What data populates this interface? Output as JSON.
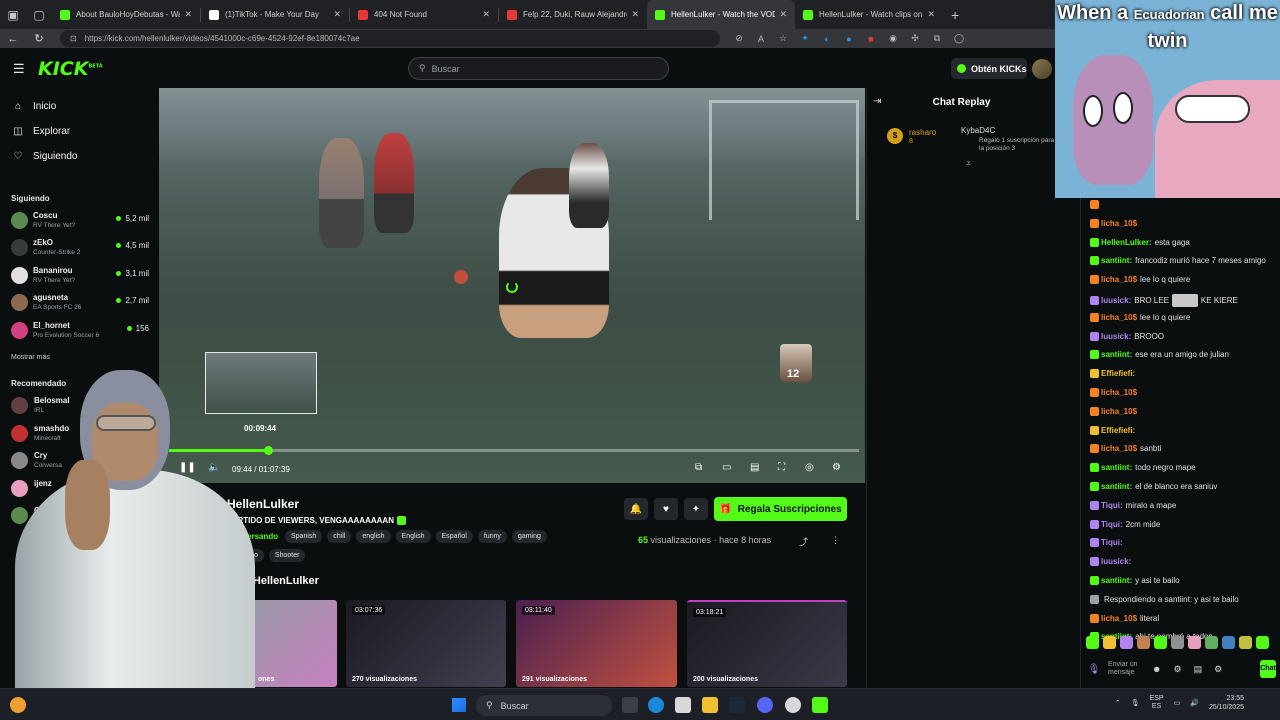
{
  "browser": {
    "tabs": [
      {
        "title": "About BauloHoyDebutas - Watch",
        "color": "#53fc18",
        "active": false
      },
      {
        "title": "(1)TikTok - Make Your Day",
        "color": "#ffffff",
        "active": false
      },
      {
        "title": "404 Not Found",
        "color": "#e53935",
        "active": false
      },
      {
        "title": "Felp 22, Duki, Rauw Alejandro - S",
        "color": "#e53935",
        "active": false
      },
      {
        "title": "HellenLulker - Watch the VOD o",
        "color": "#53fc18",
        "active": true
      },
      {
        "title": "HellenLulker - Watch clips on Ki",
        "color": "#53fc18",
        "active": false
      }
    ],
    "url": "https://kick.com/hellenlulker/videos/4541000c-c69e-4524-92ef-8e180074c7ae"
  },
  "kick": {
    "logo": "KICK",
    "logo_sup": "BETA",
    "search_placeholder": "Buscar",
    "obtener_label": "Obtén KICKs"
  },
  "sidebar": {
    "menu": [
      {
        "label": "Inicio",
        "icon": "home-icon"
      },
      {
        "label": "Explorar",
        "icon": "compass-icon"
      },
      {
        "label": "Siguiendo",
        "icon": "heart-icon"
      }
    ],
    "following_title": "Siguiendo",
    "following": [
      {
        "name": "Coscu",
        "game": "RV There Yet?",
        "viewers": "5,2 mil",
        "color": "#5a8a50"
      },
      {
        "name": "zEkO",
        "game": "Counter-Strike 2",
        "viewers": "4,5 mil",
        "color": "#3a3a3a"
      },
      {
        "name": "Bananirou",
        "game": "RV There Yet?",
        "viewers": "3,1 mil",
        "color": "#e0e0e0"
      },
      {
        "name": "agusneta",
        "game": "EA Sports FC 26",
        "viewers": "2,7 mil",
        "color": "#8c6a50"
      },
      {
        "name": "El_hornet",
        "game": "Pro Evolution Soccer 6",
        "viewers": "156",
        "color": "#d04080"
      }
    ],
    "show_more": "Mostrar más",
    "recommended_title": "Recomendado",
    "recommended": [
      {
        "name": "Belosmal",
        "game": "IRL",
        "color": "#604040"
      },
      {
        "name": "smashdo",
        "game": "Minecraft",
        "color": "#c03030"
      },
      {
        "name": "Cry",
        "game": "Conversa",
        "color": "#888888"
      },
      {
        "name": "ijenz",
        "game": "",
        "color": "#e8a0c0"
      },
      {
        "name": "Cos",
        "game": "",
        "color": "#5a8a50"
      }
    ]
  },
  "video": {
    "preview_time": "00:09:44",
    "current_time": "09:44",
    "total_time": "01:07:39",
    "progress": 0.144,
    "corner_badge": "12"
  },
  "stream": {
    "name": "HellenLulker",
    "title": "PARTIDO DE VIEWERS, VENGAAAAAAAAN",
    "category": "Conversando",
    "tags": [
      "Spanish",
      "chill",
      "english",
      "English",
      "Español",
      "funny",
      "gaming"
    ],
    "tags2": [
      "Grindeo",
      "Shooter"
    ],
    "subscribe_label": "Regala Suscripciones",
    "views_count": "65",
    "views_label": "visualizaciones",
    "time_ago": "hace 8 horas",
    "section_heading": "de HellenLulker"
  },
  "vods": [
    {
      "duration": "",
      "views": "ones",
      "c1": "#9a9aa8",
      "c2": "#c880c0"
    },
    {
      "duration": "03:07:36",
      "views": "270 visualizaciones",
      "c1": "#1a1a22",
      "c2": "#404050"
    },
    {
      "duration": "03:11:40",
      "views": "291 visualizaciones",
      "c1": "#4a2050",
      "c2": "#c05040"
    },
    {
      "duration": "03:18:21",
      "views": "200 visualizaciones",
      "c1": "#1a1a22",
      "c2": "#3a3a48"
    }
  ],
  "chat": {
    "title": "Chat Replay",
    "pinned": {
      "user1": "rasharo",
      "num1": "8",
      "user2": "KybaD4C",
      "num2": "6",
      "message": "Regaló 1 suscripción para tomar la posición 3"
    }
  },
  "meme": {
    "line1": "When a",
    "small": "Ecuadorian",
    "line1b": "call me",
    "line2": "twin"
  },
  "right_chat": {
    "lines": [
      {
        "user": "",
        "text": "",
        "color": "#f58220"
      },
      {
        "user": "licha_10$",
        "text": "",
        "color": "#f58220"
      },
      {
        "user": "HellenLulker:",
        "text": "esta gaga",
        "color": "#53fc18"
      },
      {
        "user": "santiint:",
        "text": "francodiz murió hace 7 meses amigo",
        "color": "#53fc18"
      },
      {
        "user": "licha_10$",
        "text": "lee lo q quiere",
        "color": "#f58220"
      },
      {
        "user": "luusick:",
        "text": "BRO LEE",
        "text2": "KE KIERE",
        "color": "#b084f0"
      },
      {
        "user": "licha_10$",
        "text": "lee lo q quiere",
        "color": "#f58220"
      },
      {
        "user": "luusick:",
        "text": "BROOO",
        "color": "#b084f0"
      },
      {
        "user": "santiint:",
        "text": "ese era un amigo de julian",
        "color": "#53fc18"
      },
      {
        "user": "Effiefiefi:",
        "text": "",
        "color": "#f0c030"
      },
      {
        "user": "licha_10$",
        "text": "",
        "color": "#f58220"
      },
      {
        "user": "licha_10$",
        "text": "",
        "color": "#f58220"
      },
      {
        "user": "Effiefiefi:",
        "text": "",
        "color": "#f0c030"
      },
      {
        "user": "licha_10$",
        "text": "sanbti",
        "color": "#f58220"
      },
      {
        "user": "santiint:",
        "text": "todo negro mape",
        "color": "#53fc18"
      },
      {
        "user": "santiint:",
        "text": "el de blanco era saniuv",
        "color": "#53fc18"
      },
      {
        "user": "Tiqui:",
        "text": "miralo a mape",
        "color": "#b084f0"
      },
      {
        "user": "Tiqui:",
        "text": "2cm mide",
        "color": "#b084f0"
      },
      {
        "user": "Tiqui:",
        "text": "",
        "color": "#b084f0"
      },
      {
        "user": "luusick:",
        "text": "",
        "color": "#b084f0"
      },
      {
        "user": "santiint:",
        "text": "y asi te bailo",
        "color": "#53fc18"
      },
      {
        "user": "",
        "text": "Respondiendo a santiint: y asi te bailo",
        "color": "#9aa0a6"
      },
      {
        "user": "licha_10$",
        "text": "literal",
        "color": "#f58220"
      },
      {
        "user": "santiint:",
        "text": "ahi te nombró a todos",
        "color": "#53fc18"
      }
    ],
    "input_placeholder": "Enviar un mensaje",
    "send_label": "Chat"
  },
  "taskbar": {
    "search": "Buscar",
    "lang": "ESP",
    "lang2": "ES",
    "time": "23:55",
    "date": "25/10/2025"
  }
}
